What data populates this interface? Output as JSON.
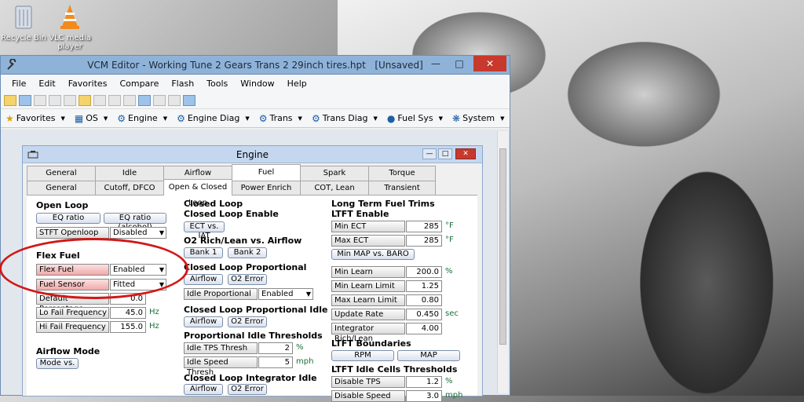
{
  "desktop": {
    "icons": [
      {
        "label": "Recycle Bin"
      },
      {
        "label": "VLC media player"
      }
    ]
  },
  "window": {
    "title": "VCM Editor - Working Tune 2 Gears Trans 2 29inch tires.hpt",
    "state": "[Unsaved]"
  },
  "menu": [
    "File",
    "Edit",
    "Favorites",
    "Compare",
    "Flash",
    "Tools",
    "Window",
    "Help"
  ],
  "toolbar2": [
    {
      "icon": "star-icon",
      "label": "Favorites"
    },
    {
      "icon": "os-icon",
      "label": "OS"
    },
    {
      "icon": "engine-icon",
      "label": "Engine"
    },
    {
      "icon": "engine-diag-icon",
      "label": "Engine Diag"
    },
    {
      "icon": "trans-icon",
      "label": "Trans"
    },
    {
      "icon": "trans-diag-icon",
      "label": "Trans Diag"
    },
    {
      "icon": "fuel-icon",
      "label": "Fuel Sys"
    },
    {
      "icon": "system-icon",
      "label": "System"
    }
  ],
  "engine": {
    "title": "Engine",
    "tabs_top": [
      "General",
      "Idle",
      "Airflow",
      "Fuel",
      "Spark",
      "Torque Management"
    ],
    "tabs_sub": [
      "General",
      "Cutoff, DFCO",
      "Open & Closed Loop",
      "Power Enrich",
      "COT, Lean Cruise",
      "Transient"
    ],
    "open_loop": {
      "heading": "Open Loop",
      "eq_ratio": "EQ ratio",
      "eq_ratio_alcohol": "EQ ratio (alcohol)",
      "stft_label": "STFT Openloop",
      "stft_value": "Disabled"
    },
    "flex_fuel": {
      "heading": "Flex Fuel",
      "flex_label": "Flex Fuel",
      "flex_value": "Enabled",
      "sensor_label": "Fuel Sensor",
      "sensor_value": "Fitted",
      "default_label": "Default Percentage",
      "default_value": "0.0",
      "lo_label": "Lo Fail Frequency",
      "lo_value": "45.0",
      "hi_label": "Hi Fail Frequency",
      "hi_value": "155.0",
      "unit": "Hz"
    },
    "airflow_mode": {
      "heading": "Airflow Mode",
      "button": "Mode vs."
    },
    "closed_loop": {
      "heading": "Closed Loop",
      "enable_heading": "Closed Loop Enable",
      "ect_iat": "ECT vs. IAT"
    },
    "o2_rich_lean": {
      "heading": "O2 Rich/Lean vs. Airflow",
      "bank1": "Bank 1",
      "bank2": "Bank 2"
    },
    "cl_proportional": {
      "heading": "Closed Loop Proportional",
      "airflow": "Airflow",
      "o2_error": "O2 Error",
      "idle_prop_label": "Idle Proportional",
      "idle_prop_value": "Enabled"
    },
    "cl_prop_idle": {
      "heading": "Closed Loop Proportional Idle",
      "airflow": "Airflow",
      "o2_error": "O2 Error"
    },
    "prop_idle_thresh": {
      "heading": "Proportional Idle Thresholds",
      "tps_label": "Idle TPS Thresh",
      "tps_value": "2",
      "tps_unit": "%",
      "speed_label": "Idle Speed Thresh",
      "speed_value": "5",
      "speed_unit": "mph"
    },
    "cl_integrator_idle": {
      "heading": "Closed Loop Integrator Idle",
      "airflow": "Airflow",
      "o2_error": "O2 Error"
    },
    "ltft": {
      "heading": "Long Term Fuel Trims",
      "enable_heading": "LTFT Enable",
      "min_ect_label": "Min ECT",
      "min_ect_value": "285",
      "max_ect_label": "Max ECT",
      "max_ect_value": "285",
      "ect_unit": "°F",
      "min_map_button": "Min MAP vs. BARO",
      "min_learn_label": "Min Learn",
      "min_learn_value": "200.0",
      "min_learn_unit": "%",
      "min_learn_limit_label": "Min Learn Limit",
      "min_learn_limit_value": "1.25",
      "max_learn_limit_label": "Max Learn Limit",
      "max_learn_limit_value": "0.80",
      "update_rate_label": "Update Rate",
      "update_rate_value": "0.450",
      "update_rate_unit": "sec",
      "integrator_label": "Integrator Rich/Lean",
      "integrator_value": "4.00"
    },
    "ltft_boundaries": {
      "heading": "LTFT Boundaries",
      "rpm": "RPM",
      "map": "MAP"
    },
    "ltft_idle": {
      "heading": "LTFT Idle Cells Thresholds",
      "disable_tps_label": "Disable TPS",
      "disable_tps_value": "1.2",
      "disable_tps_unit": "%",
      "disable_speed_label": "Disable Speed",
      "disable_speed_value": "3.0",
      "disable_speed_unit": "mph"
    }
  },
  "colors": {
    "annotation_circle": "#d21818",
    "title_bar": "#8fb2d8",
    "close_button": "#c7392c"
  }
}
